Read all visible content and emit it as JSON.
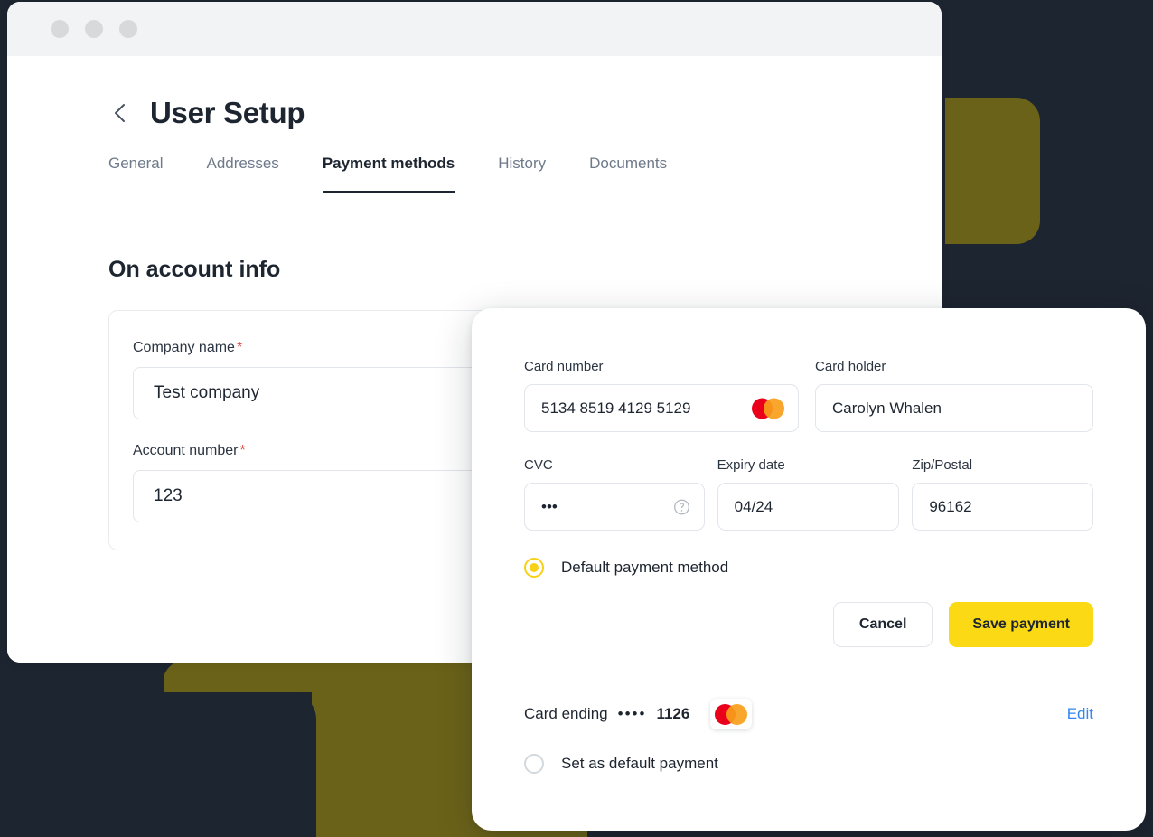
{
  "window": {
    "traffic_lights": [
      "close",
      "minimize",
      "maximize"
    ]
  },
  "page": {
    "back_icon": "chevron-left-icon",
    "title": "User Setup"
  },
  "tabs": [
    {
      "label": "General",
      "active": false
    },
    {
      "label": "Addresses",
      "active": false
    },
    {
      "label": "Payment methods",
      "active": true
    },
    {
      "label": "History",
      "active": false
    },
    {
      "label": "Documents",
      "active": false
    }
  ],
  "on_account": {
    "section_title": "On account info",
    "fields": [
      {
        "label": "Company name",
        "required_mark": "*",
        "value": "Test company"
      },
      {
        "label": "Account number",
        "required_mark": "*",
        "value": "123"
      }
    ]
  },
  "payment_modal": {
    "card_number": {
      "label": "Card number",
      "value": "5134 8519 4129 5129",
      "brand_icon": "mastercard-icon"
    },
    "card_holder": {
      "label": "Card holder",
      "value": "Carolyn Whalen"
    },
    "cvc": {
      "label": "CVC",
      "value": "•••",
      "help_icon": "question-circle-icon"
    },
    "expiry": {
      "label": "Expiry date",
      "value": "04/24"
    },
    "zip": {
      "label": "Zip/Postal",
      "value": "96162"
    },
    "default_radio": {
      "label": "Default payment method",
      "selected": true
    },
    "buttons": {
      "cancel": "Cancel",
      "save": "Save payment"
    },
    "saved_card": {
      "prefix": "Card ending",
      "mask": "••••",
      "last4": "1126",
      "brand_icon": "mastercard-icon",
      "edit_label": "Edit",
      "default_radio_label": "Set as default payment",
      "default_radio_selected": false
    }
  },
  "colors": {
    "background": "#1d2530",
    "accent_olive": "#6b6219",
    "brand_yellow": "#fbd914",
    "link_blue": "#2f87f3",
    "required_red": "#e0483f",
    "mastercard_red": "#eb001b",
    "mastercard_orange": "#f79e1b"
  }
}
